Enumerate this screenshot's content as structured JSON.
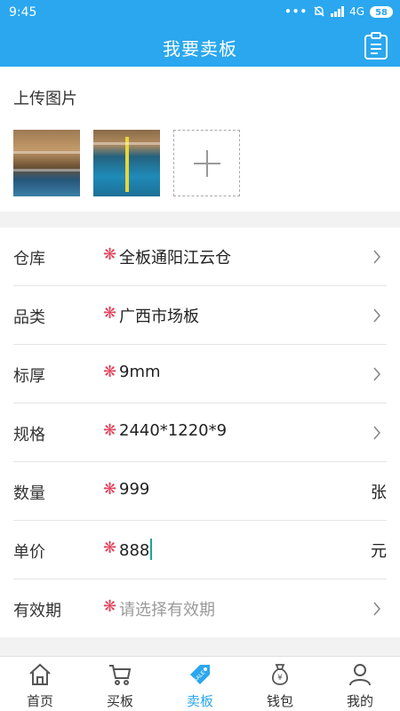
{
  "status": {
    "time": "9:45",
    "network": "4G",
    "battery": "58"
  },
  "header": {
    "title": "我要卖板"
  },
  "upload": {
    "label": "上传图片"
  },
  "form": {
    "rows": [
      {
        "label": "仓库",
        "value": "全板通阳江云仓",
        "trailing": "chevron"
      },
      {
        "label": "品类",
        "value": "广西市场板",
        "trailing": "chevron"
      },
      {
        "label": "标厚",
        "value": "9mm",
        "trailing": "chevron"
      },
      {
        "label": "规格",
        "value": "2440*1220*9",
        "trailing": "chevron"
      },
      {
        "label": "数量",
        "value": "999",
        "unit": "张"
      },
      {
        "label": "单价",
        "value": "888",
        "unit": "元"
      },
      {
        "label": "有效期",
        "placeholder": "请选择有效期",
        "trailing": "chevron"
      }
    ],
    "required_mark": "❋"
  },
  "tabbar": {
    "active_index": 2,
    "tabs": [
      {
        "label": "首页",
        "icon": "home-icon"
      },
      {
        "label": "买板",
        "icon": "cart-icon"
      },
      {
        "label": "卖板",
        "icon": "sale-tag-icon",
        "badge": "SALE"
      },
      {
        "label": "钱包",
        "icon": "money-bag-icon",
        "symbol": "¥"
      },
      {
        "label": "我的",
        "icon": "user-icon"
      }
    ]
  },
  "colors": {
    "primary": "#2aa7ee",
    "required": "#e0415a",
    "caret": "#1aa59a"
  }
}
